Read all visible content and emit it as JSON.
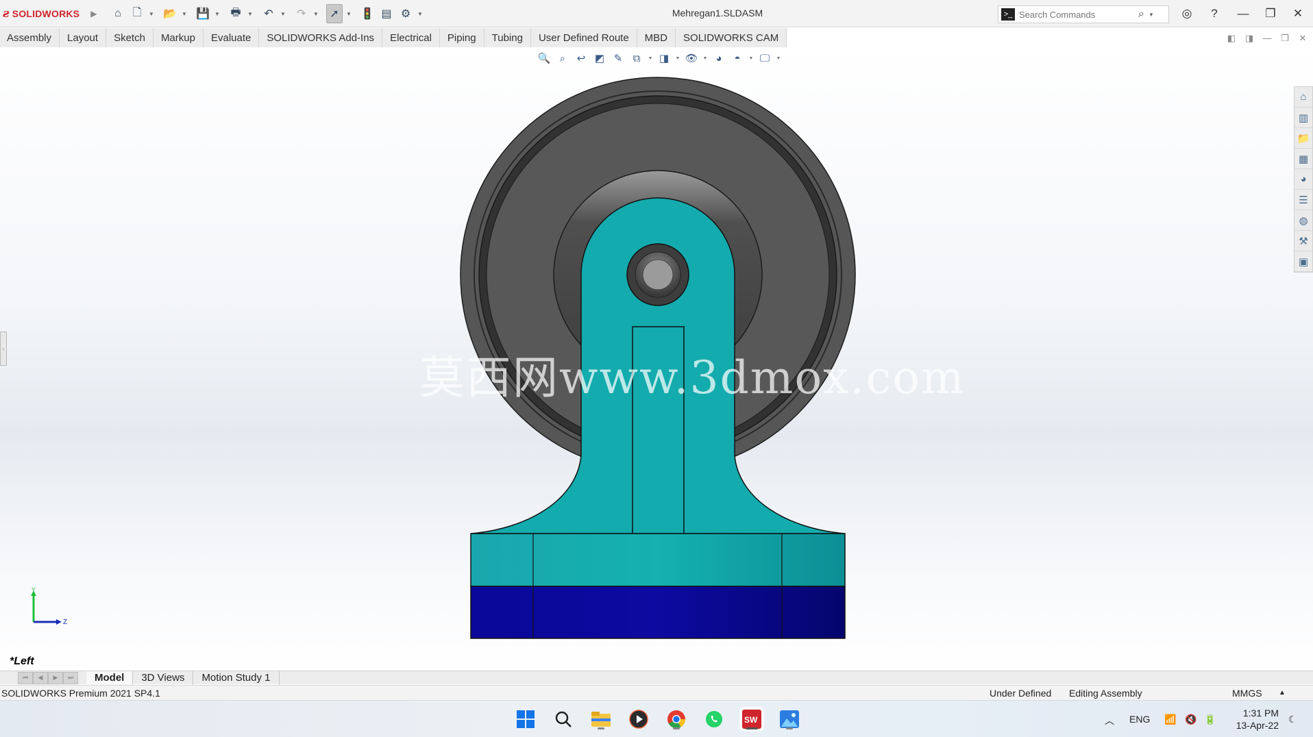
{
  "titlebar": {
    "brand": "SOLIDWORKS",
    "document_title": "Mehregan1.SLDASM",
    "search_placeholder": "Search Commands",
    "quick_access": [
      "home-icon",
      "new-document-icon",
      "open-icon",
      "save-icon",
      "print-icon",
      "undo-icon",
      "redo-icon",
      "select-icon",
      "rebuild-icon",
      "file-properties-icon",
      "options-icon"
    ]
  },
  "command_tabs": [
    "Assembly",
    "Layout",
    "Sketch",
    "Markup",
    "Evaluate",
    "SOLIDWORKS Add-Ins",
    "Electrical",
    "Piping",
    "Tubing",
    "User Defined Route",
    "MBD",
    "SOLIDWORKS CAM"
  ],
  "viewport": {
    "view_name": "*Left",
    "watermark": "莫西网www.3dmox.com",
    "triad": {
      "y": "Y",
      "z": "Z"
    },
    "colors": {
      "wheel_dark": "#545454",
      "bracket": "#13abad",
      "base": "#0c0aa0"
    }
  },
  "bottom_tabs": {
    "model": "Model",
    "views3d": "3D Views",
    "motion": "Motion Study 1"
  },
  "status": {
    "product": "SOLIDWORKS Premium 2021 SP4.1",
    "state": "Under Defined",
    "mode": "Editing Assembly",
    "units": "MMGS"
  },
  "taskbar": {
    "lang": "ENG",
    "time": "1:31 PM",
    "date": "13-Apr-22"
  }
}
